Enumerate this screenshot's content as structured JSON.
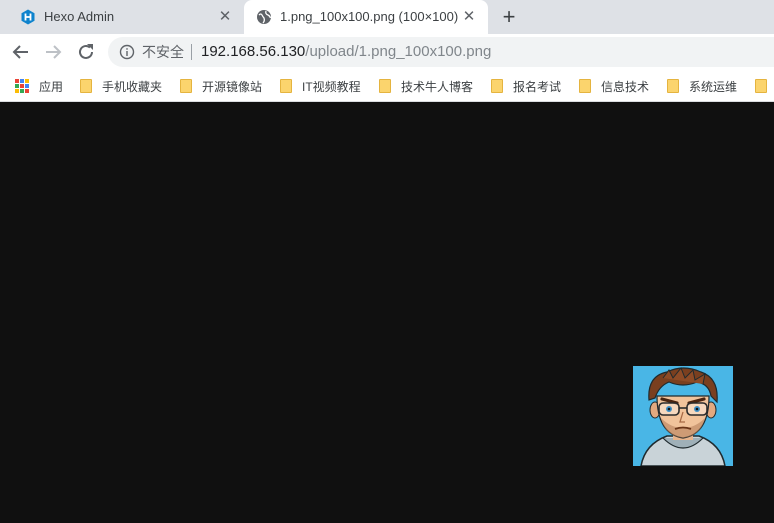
{
  "tabs": [
    {
      "title": "Hexo Admin",
      "icon": "hexo-logo-icon",
      "active": false
    },
    {
      "title": "1.png_100x100.png (100×100)",
      "icon": "globe-icon",
      "active": true
    }
  ],
  "toolbar": {
    "security_label": "不安全",
    "url_host": "192.168.56.130",
    "url_path": "/upload/1.png_100x100.png"
  },
  "bookmarks": {
    "apps_label": "应用",
    "items": [
      "手机收藏夹",
      "开源镜像站",
      "IT视频教程",
      "技术牛人博客",
      "报名考试",
      "信息技术",
      "系统运维"
    ]
  },
  "image": {
    "alt": "1.png_100x100.png",
    "width": 100,
    "height": 100
  },
  "colors": {
    "tab_strip": "#dee1e6",
    "page_background": "#101010",
    "avatar_background": "#49b6e6",
    "folder": "#fbd46d"
  }
}
